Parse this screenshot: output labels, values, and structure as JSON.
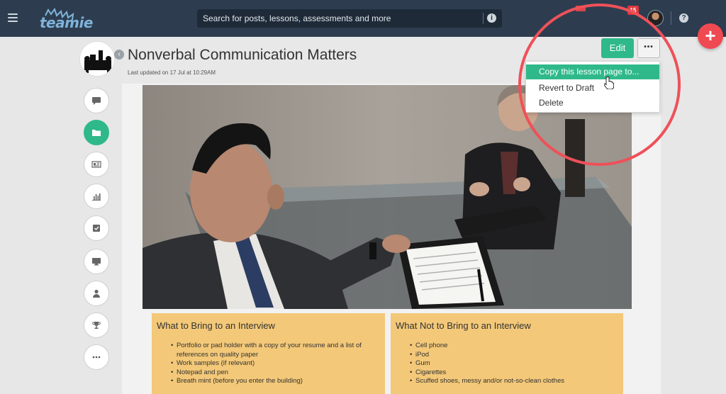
{
  "app": {
    "logo_text": "teamie",
    "search_placeholder": "Search for posts, lessons, assessments and more",
    "notification_count": "15"
  },
  "page": {
    "title": "Nonverbal Communication Matters",
    "updated": "Last updated on 17 Jul at 10:29AM",
    "edit_label": "Edit",
    "more_label": "•••"
  },
  "menu": {
    "items": [
      {
        "label": "Copy this lesson page to..."
      },
      {
        "label": "Revert to Draft"
      },
      {
        "label": "Delete"
      }
    ]
  },
  "sidebar": {
    "icons": [
      "chat-icon",
      "folder-icon",
      "newspaper-icon",
      "bar-chart-icon",
      "checkbox-icon",
      "monitor-icon",
      "user-icon",
      "trophy-icon",
      "more-icon"
    ]
  },
  "panels": {
    "left": {
      "title": "What to Bring to an Interview",
      "items": [
        "Portfolio or pad holder with a copy of your resume and a list of references on quality paper",
        "Work samples (if relevant)",
        "Notepad and pen",
        "Breath mint (before you enter the building)"
      ]
    },
    "right": {
      "title": "What Not to Bring to an Interview",
      "items": [
        "Cell phone",
        "iPod",
        "Gum",
        "Cigarettes",
        "Scuffed shoes, messy and/or not-so-clean clothes"
      ]
    }
  },
  "colors": {
    "topbar": "#2d3d4f",
    "accent_green": "#2fb98a",
    "fab_red": "#ef4a52",
    "panel_yellow": "#f3c878",
    "annotation_red": "#ee5159"
  }
}
